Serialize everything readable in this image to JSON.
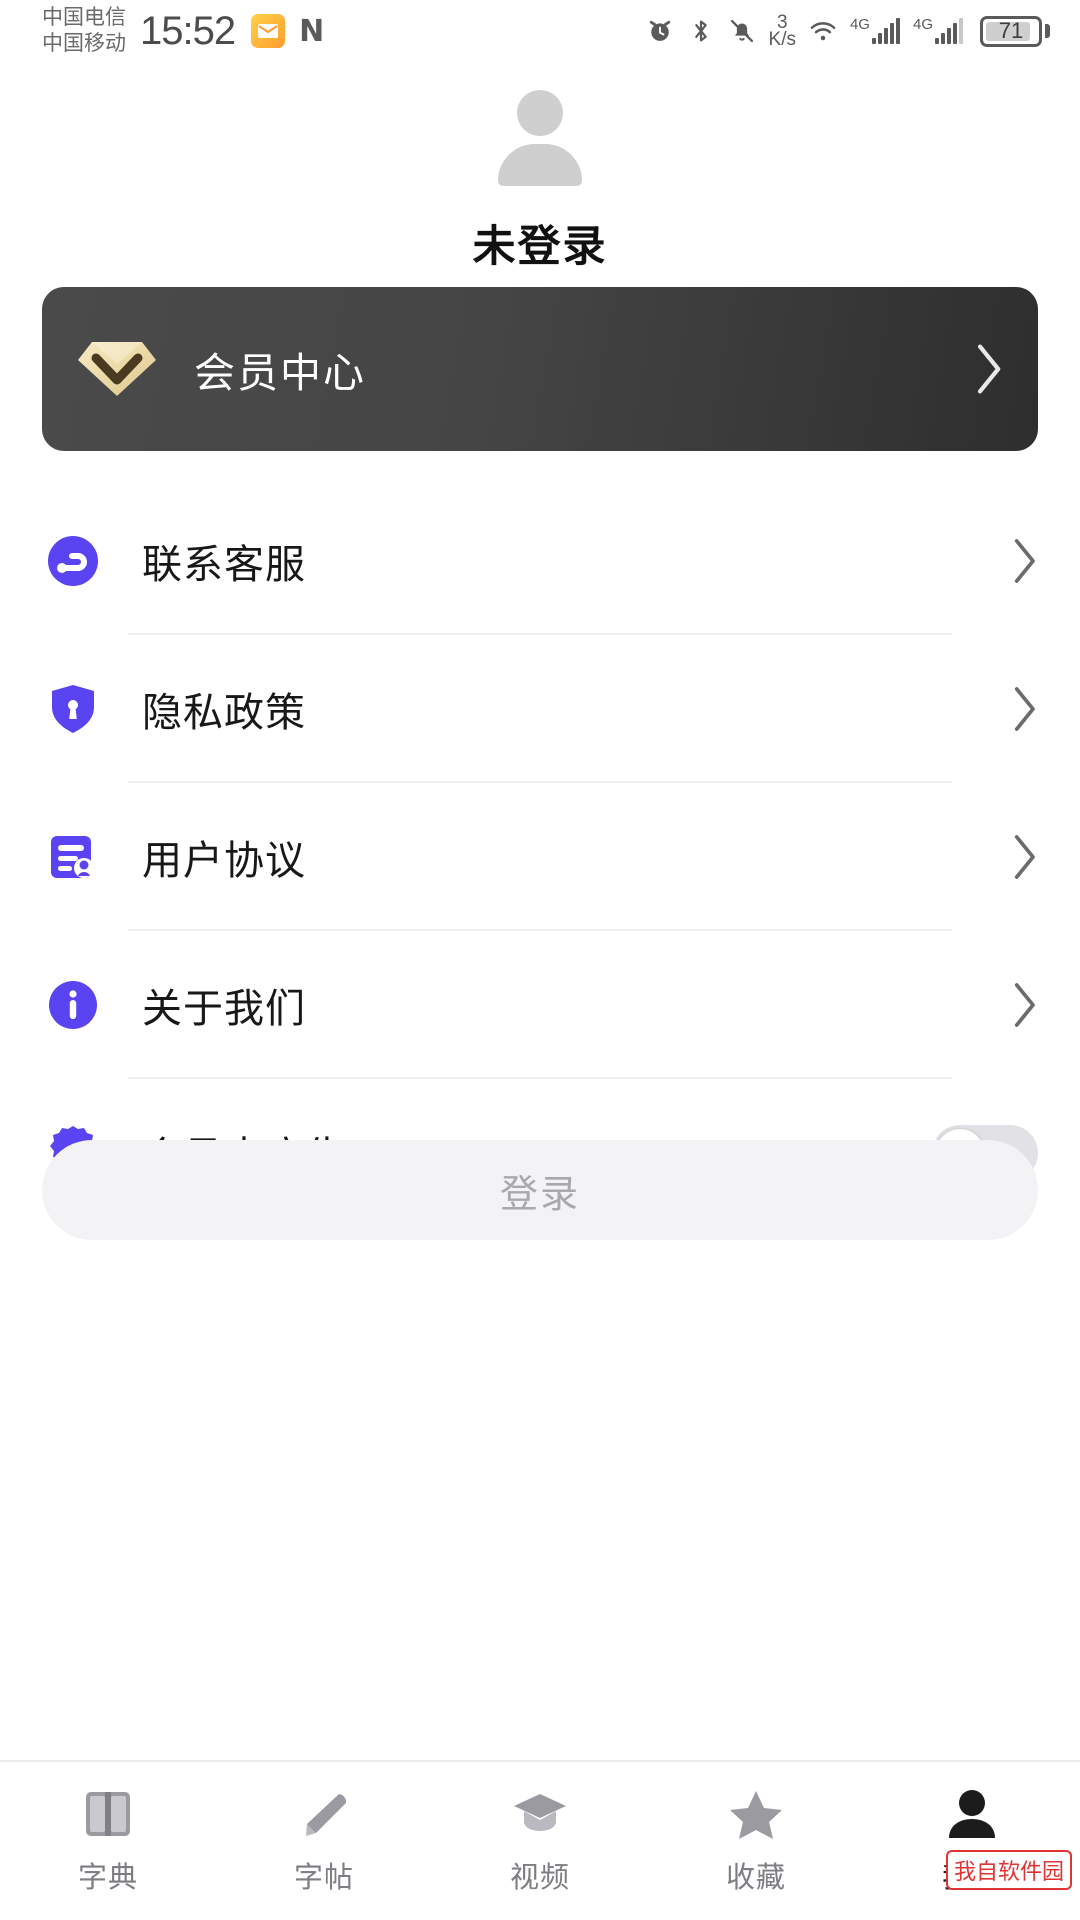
{
  "status_bar": {
    "carrier_primary": "中国电信",
    "carrier_secondary": "中国移动",
    "time": "15:52",
    "mail_icon": "mail-icon",
    "nfc_icon": "nfc-icon",
    "nfc_glyph": "N",
    "alarm_icon": "alarm-icon",
    "bluetooth_icon": "bluetooth-icon",
    "mute_icon": "bell-muted-icon",
    "net_speed_value": "3",
    "net_speed_unit": "K/s",
    "wifi_icon": "wifi-icon",
    "sim1_network": "4G",
    "sim2_network": "4G",
    "battery_level": "71"
  },
  "profile": {
    "avatar_icon": "person-placeholder-icon",
    "nickname": "未登录"
  },
  "vip_card": {
    "icon": "gem-diamond-icon",
    "label": "会员中心",
    "chevron": "chevron-right-icon"
  },
  "menu": {
    "items": [
      {
        "icon": "headset-support-icon",
        "label": "联系客服",
        "accessory": "chevron"
      },
      {
        "icon": "shield-lock-icon",
        "label": "隐私政策",
        "accessory": "chevron"
      },
      {
        "icon": "contract-document-icon",
        "label": "用户协议",
        "accessory": "chevron"
      },
      {
        "icon": "info-circle-icon",
        "label": "关于我们",
        "accessory": "chevron"
      },
      {
        "icon": "gear-icon",
        "label": "会员去广告",
        "accessory": "toggle",
        "toggle_on": false
      }
    ]
  },
  "login": {
    "label": "登录"
  },
  "tabbar": {
    "items": [
      {
        "icon": "book-icon",
        "label": "字典",
        "active": false
      },
      {
        "icon": "pen-icon",
        "label": "字帖",
        "active": false
      },
      {
        "icon": "graduate-cap-icon",
        "label": "视频",
        "active": false
      },
      {
        "icon": "star-icon",
        "label": "收藏",
        "active": false
      },
      {
        "icon": "person-icon",
        "label": "我的",
        "active": true
      }
    ]
  },
  "watermark": {
    "text": "我自软件园"
  },
  "colors": {
    "accent_purple": "#5a43f0",
    "card_dark": "#3d3d3d",
    "gem_gold": "#efdcae",
    "watermark_red": "#e03434",
    "login_bg": "#f3f3f5"
  }
}
